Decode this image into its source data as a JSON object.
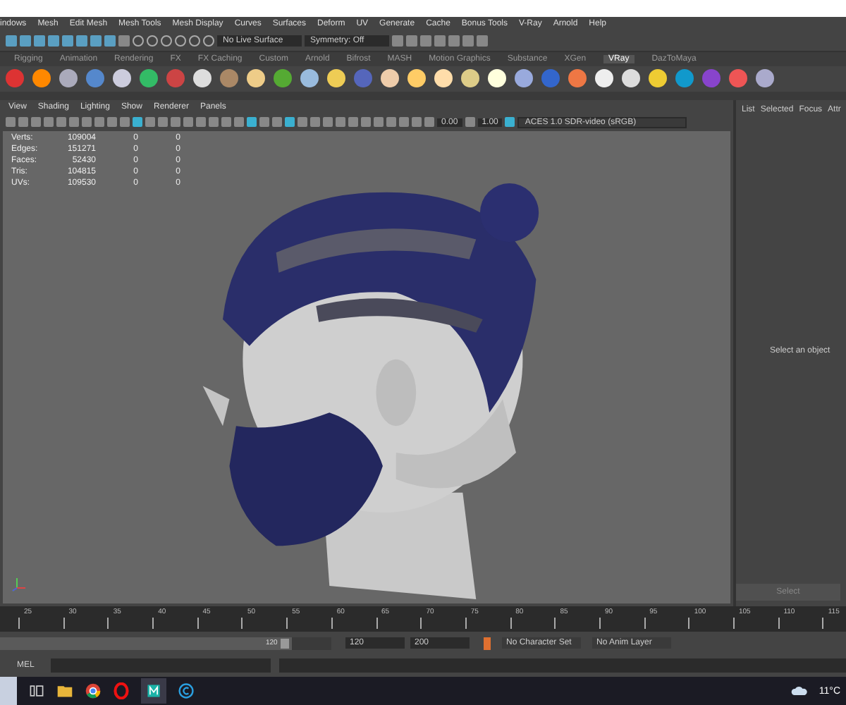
{
  "menu_bar": [
    "indows",
    "Mesh",
    "Edit Mesh",
    "Mesh Tools",
    "Mesh Display",
    "Curves",
    "Surfaces",
    "Deform",
    "UV",
    "Generate",
    "Cache",
    "Bonus Tools",
    "V-Ray",
    "Arnold",
    "Help"
  ],
  "status_line": {
    "live_surface": "No Live Surface",
    "symmetry": "Symmetry: Off"
  },
  "shelf_tabs": [
    {
      "label": "Rigging",
      "selected": false
    },
    {
      "label": "Animation",
      "selected": false
    },
    {
      "label": "Rendering",
      "selected": false
    },
    {
      "label": "FX",
      "selected": false
    },
    {
      "label": "FX Caching",
      "selected": false
    },
    {
      "label": "Custom",
      "selected": false
    },
    {
      "label": "Arnold",
      "selected": false
    },
    {
      "label": "Bifrost",
      "selected": false
    },
    {
      "label": "MASH",
      "selected": false
    },
    {
      "label": "Motion Graphics",
      "selected": false
    },
    {
      "label": "Substance",
      "selected": false
    },
    {
      "label": "XGen",
      "selected": false
    },
    {
      "label": "VRay",
      "selected": true
    },
    {
      "label": "DazToMaya",
      "selected": false
    }
  ],
  "viewport": {
    "menus": [
      "View",
      "Shading",
      "Lighting",
      "Show",
      "Renderer",
      "Panels"
    ],
    "exposure": "0.00",
    "gamma": "1.00",
    "color_space": "ACES 1.0 SDR-video (sRGB)",
    "stats": [
      {
        "label": "Verts:",
        "value": "109004",
        "column_3": "0",
        "column_4": "0"
      },
      {
        "label": "Edges:",
        "value": "151271",
        "column_3": "0",
        "column_4": "0"
      },
      {
        "label": "Faces:",
        "value": "52430",
        "column_3": "0",
        "column_4": "0"
      },
      {
        "label": "Tris:",
        "value": "104815",
        "column_3": "0",
        "column_4": "0"
      },
      {
        "label": "UVs:",
        "value": "109530",
        "column_3": "0",
        "column_4": "0"
      }
    ]
  },
  "attribute_panel": {
    "tabs": [
      "List",
      "Selected",
      "Focus",
      "Attr"
    ],
    "message": "Select an object",
    "button": "Select"
  },
  "time_slider": {
    "ticks": [
      "25",
      "30",
      "35",
      "40",
      "45",
      "50",
      "55",
      "60",
      "65",
      "70",
      "75",
      "80",
      "85",
      "90",
      "95",
      "100",
      "105",
      "110",
      "115"
    ]
  },
  "range_slider": {
    "level": 0.88,
    "handle": "120",
    "end_time": "120",
    "max_time": "200",
    "character_set": "No Character Set",
    "anim_layer": "No Anim Layer"
  },
  "command_line": {
    "language": "MEL"
  },
  "taskbar": {
    "weather": "11°C"
  }
}
